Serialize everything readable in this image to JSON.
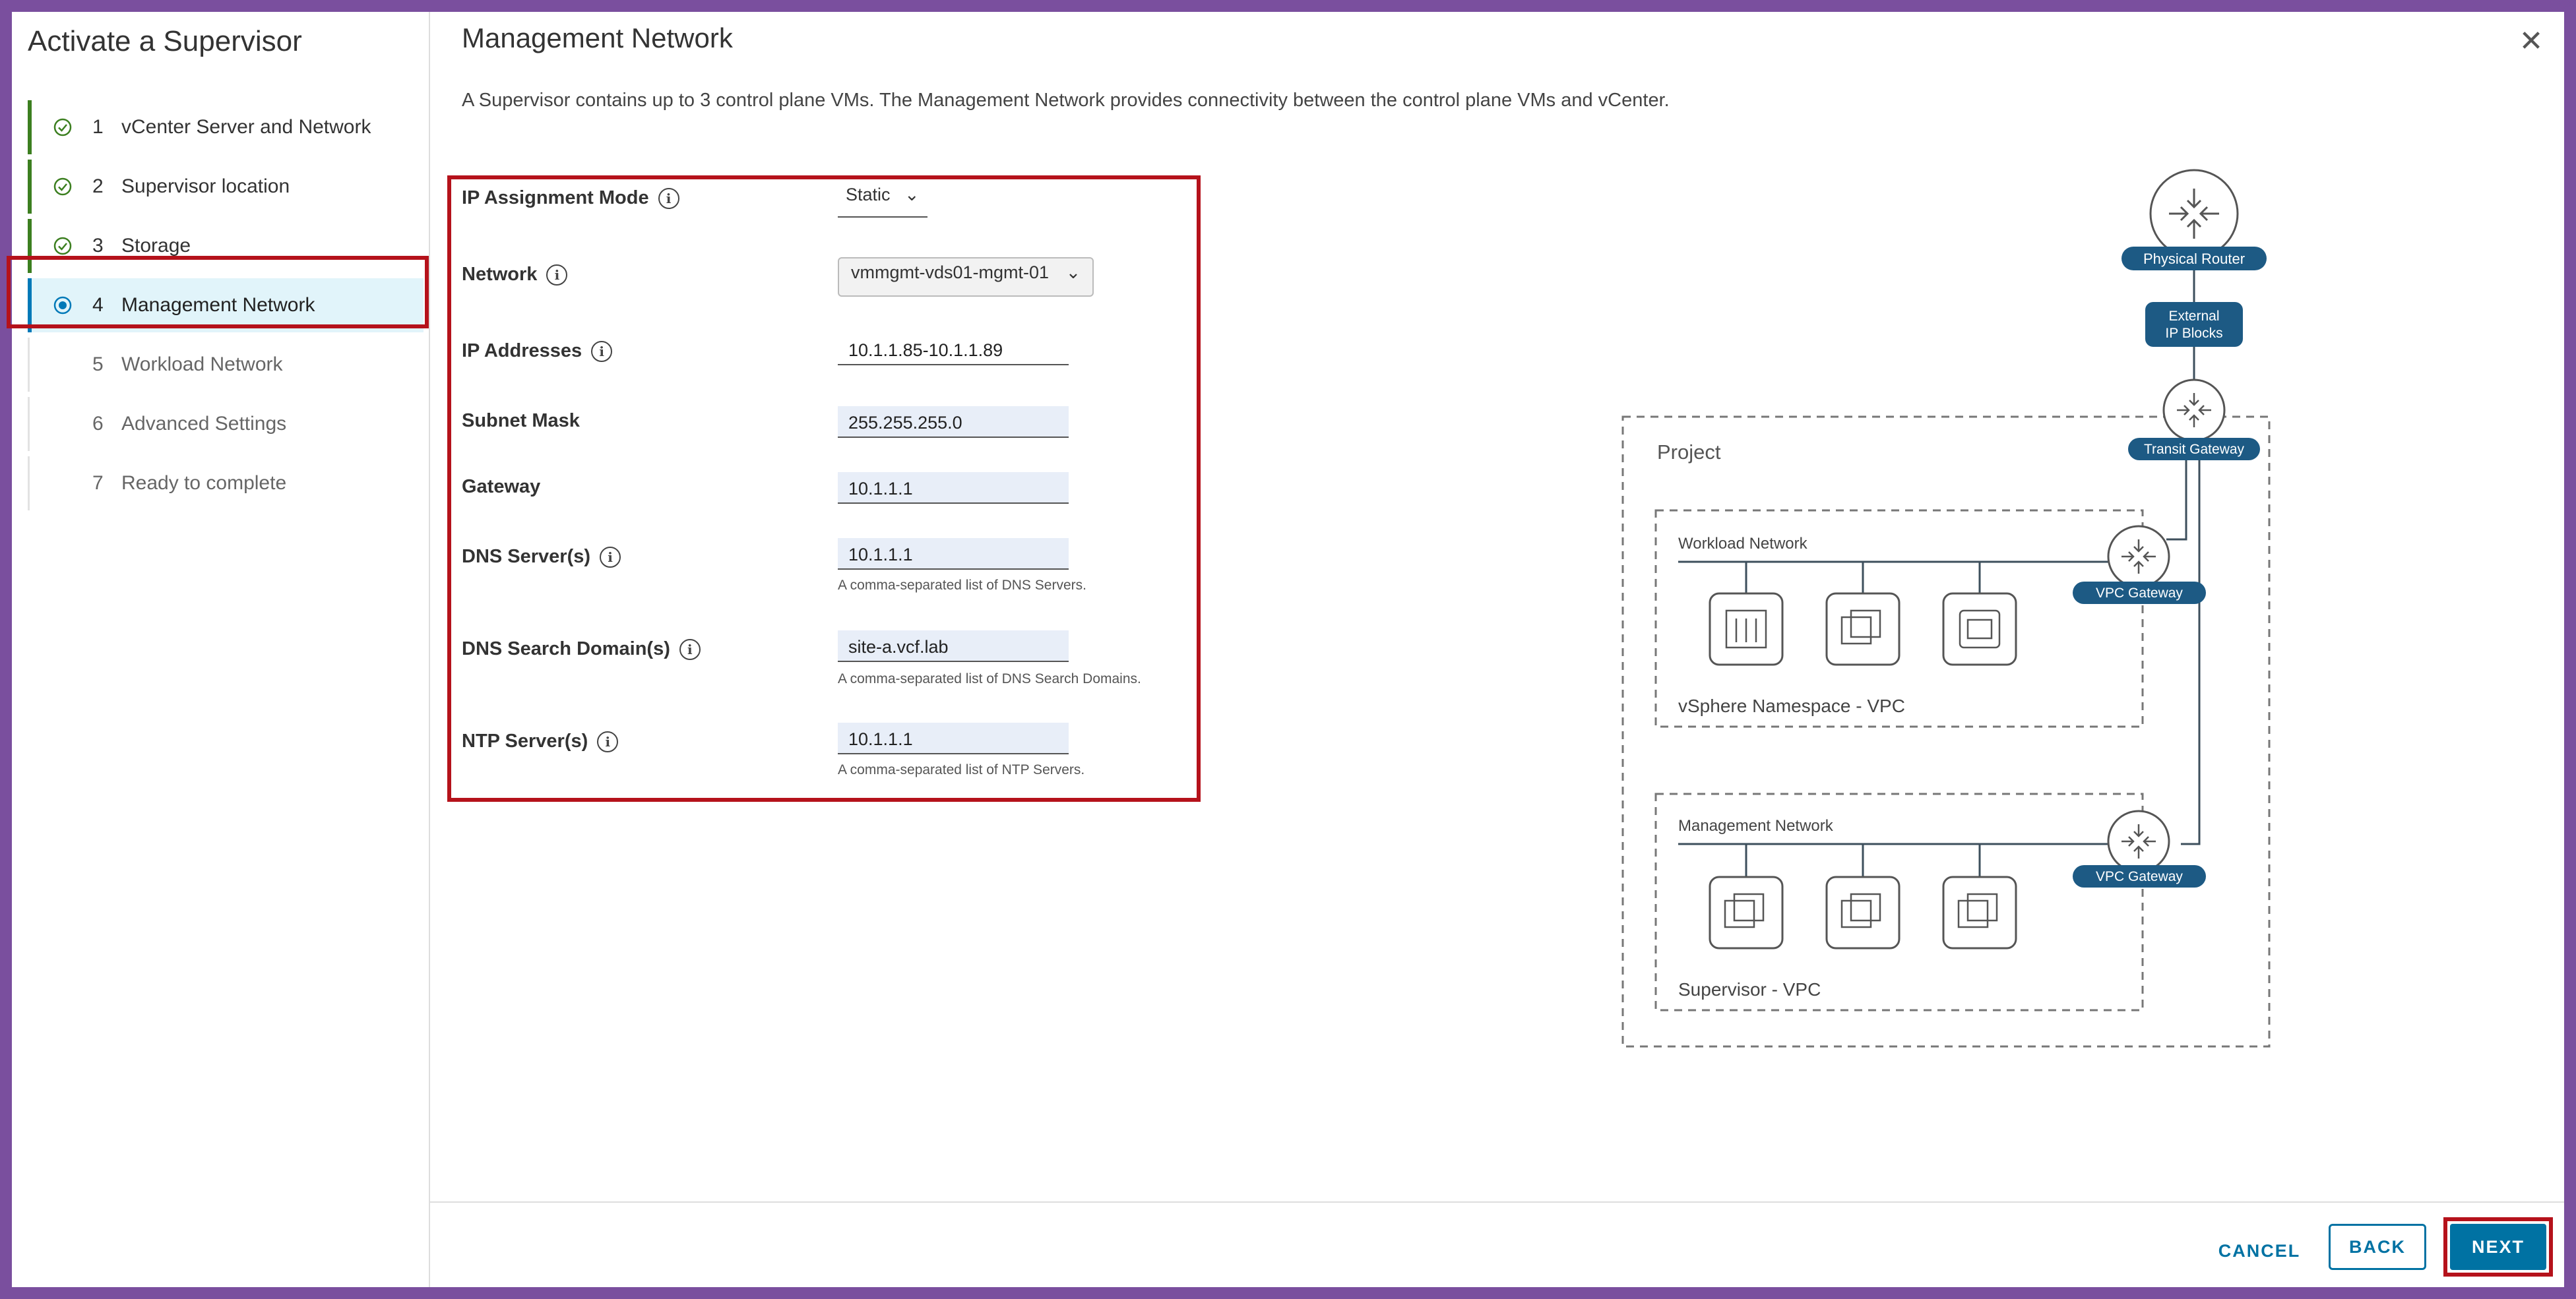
{
  "wizard": {
    "title": "Activate a Supervisor",
    "steps": [
      {
        "num": "1",
        "label": "vCenter Server and Network",
        "state": "done"
      },
      {
        "num": "2",
        "label": "Supervisor location",
        "state": "done"
      },
      {
        "num": "3",
        "label": "Storage",
        "state": "done"
      },
      {
        "num": "4",
        "label": "Management Network",
        "state": "active"
      },
      {
        "num": "5",
        "label": "Workload Network",
        "state": "todo"
      },
      {
        "num": "6",
        "label": "Advanced Settings",
        "state": "todo"
      },
      {
        "num": "7",
        "label": "Ready to complete",
        "state": "todo"
      }
    ]
  },
  "page": {
    "title": "Management Network",
    "description": "A Supervisor contains up to 3 control plane VMs. The Management Network provides connectivity between the control plane VMs and vCenter.",
    "close_icon": "close-icon"
  },
  "form": {
    "ip_mode": {
      "label": "IP Assignment Mode",
      "value": "Static"
    },
    "network": {
      "label": "Network",
      "value": "vmmgmt-vds01-mgmt-01"
    },
    "ip_addresses": {
      "label": "IP Addresses",
      "value": "10.1.1.85-10.1.1.89"
    },
    "subnet_mask": {
      "label": "Subnet Mask",
      "value": "255.255.255.0"
    },
    "gateway": {
      "label": "Gateway",
      "value": "10.1.1.1"
    },
    "dns_servers": {
      "label": "DNS Server(s)",
      "value": "10.1.1.1",
      "hint": "A comma-separated list of DNS Servers."
    },
    "dns_search": {
      "label": "DNS Search Domain(s)",
      "value": "site-a.vcf.lab",
      "hint": "A comma-separated list of DNS Search Domains."
    },
    "ntp_servers": {
      "label": "NTP Server(s)",
      "value": "10.1.1.1",
      "hint": "A comma-separated list of NTP Servers."
    }
  },
  "diagram": {
    "physical_router": "Physical Router",
    "external_ip_line1": "External",
    "external_ip_line2": "IP Blocks",
    "transit_gateway": "Transit Gateway",
    "project": "Project",
    "workload_network": "Workload Network",
    "vpc_gateway_1": "VPC Gateway",
    "namespace_vpc": "vSphere Namespace - VPC",
    "management_network": "Management Network",
    "vpc_gateway_2": "VPC Gateway",
    "supervisor_vpc": "Supervisor - VPC"
  },
  "footer": {
    "cancel": "CANCEL",
    "back": "BACK",
    "next": "NEXT"
  },
  "colors": {
    "accent": "#0072a3",
    "highlight": "#b5121b",
    "frame": "#7a4f9e",
    "done": "#3c7f20",
    "diagram_pill": "#1d5a84"
  }
}
